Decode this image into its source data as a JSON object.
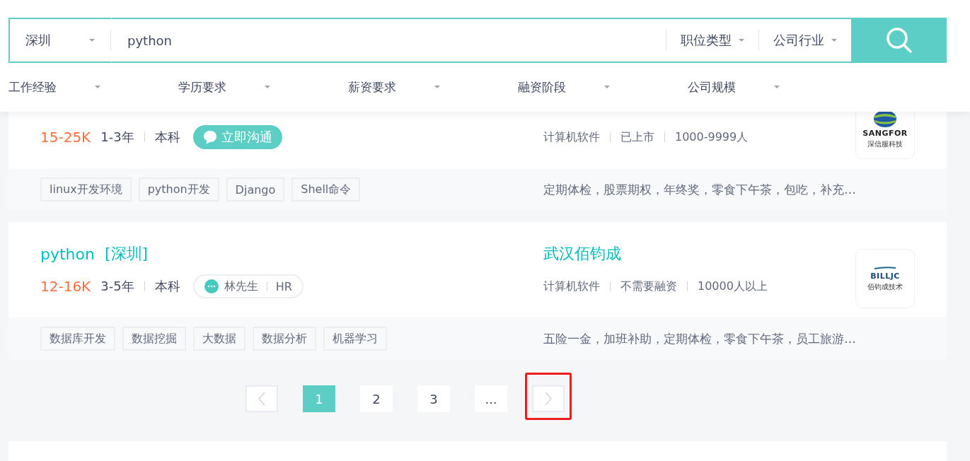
{
  "search": {
    "city": "深圳",
    "query": "python",
    "selects": [
      "职位类型",
      "公司行业"
    ]
  },
  "filters": [
    "工作经验",
    "学历要求",
    "薪资要求",
    "融资阶段",
    "公司规模"
  ],
  "jobs": [
    {
      "salary": "15-25K",
      "experience": "1-3年",
      "education": "本科",
      "contact": {
        "kind": "chat",
        "label": "立即沟通"
      },
      "company_info": [
        "计算机软件",
        "已上市",
        "1000-9999人"
      ],
      "logo": {
        "kind": "sangfor",
        "texts": [
          "SANGFOR",
          "深信服科技"
        ]
      },
      "tags": [
        "linux开发环境",
        "python开发",
        "Django",
        "Shell命令"
      ],
      "benefits": "定期体检，股票期权，年终奖，零食下午茶，包吃，补充…"
    },
    {
      "title": "python",
      "location": "[深圳]",
      "salary": "12-16K",
      "experience": "3-5年",
      "education": "本科",
      "contact": {
        "kind": "recruiter",
        "name": "林先生",
        "role": "HR"
      },
      "company": "武汉佰钧成",
      "company_info": [
        "计算机软件",
        "不需要融资",
        "10000人以上"
      ],
      "logo": {
        "kind": "billjc",
        "texts": [
          "BILLJC",
          "佰钧成技术"
        ]
      },
      "tags": [
        "数据库开发",
        "数据挖掘",
        "大数据",
        "数据分析",
        "机器学习"
      ],
      "benefits": "五险一金，加班补助，定期体检，零食下午茶，员工旅游…"
    }
  ],
  "pagination": {
    "pages": [
      {
        "label": "1",
        "selected": true
      },
      {
        "label": "2",
        "selected": false
      },
      {
        "label": "3",
        "selected": false
      },
      {
        "label": "...",
        "selected": false
      }
    ],
    "next_highlighted": true
  }
}
